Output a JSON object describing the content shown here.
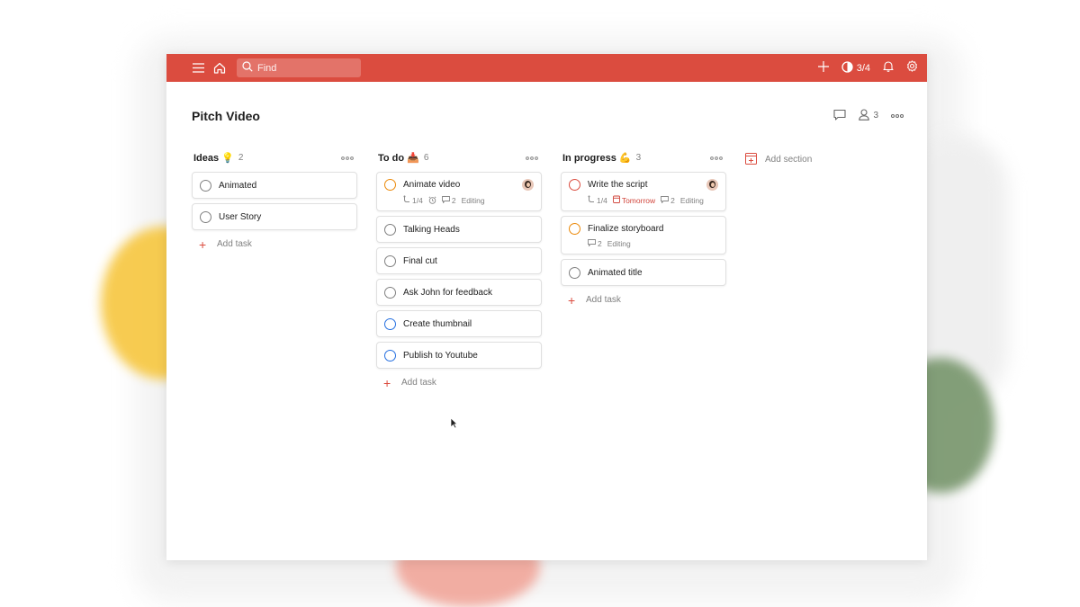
{
  "topbar": {
    "search_placeholder": "Find",
    "karma_label": "3/4",
    "icons": [
      "menu-icon",
      "home-icon",
      "search-icon",
      "plus-icon",
      "karma-icon",
      "bell-icon",
      "gear-icon"
    ]
  },
  "header": {
    "title": "Pitch Video",
    "collaborators_count": "3"
  },
  "columns": [
    {
      "name": "Ideas",
      "emoji": "💡",
      "count": "2",
      "tasks": [
        {
          "name": "Animated",
          "priority": "none"
        },
        {
          "name": "User Story",
          "priority": "none"
        }
      ],
      "add_task_label": "Add task"
    },
    {
      "name": "To do",
      "emoji": "📥",
      "count": "6",
      "tasks": [
        {
          "name": "Animate video",
          "priority": "p2",
          "subtasks": "1/4",
          "comments": "2",
          "label": "Editing",
          "has_reminder": true
        },
        {
          "name": "Talking Heads",
          "priority": "none"
        },
        {
          "name": "Final cut",
          "priority": "none"
        },
        {
          "name": "Ask John for feedback",
          "priority": "none"
        },
        {
          "name": "Create thumbnail",
          "priority": "p3"
        },
        {
          "name": "Publish to Youtube",
          "priority": "p3"
        }
      ],
      "add_task_label": "Add task"
    },
    {
      "name": "In progress",
      "emoji": "💪",
      "count": "3",
      "tasks": [
        {
          "name": "Write the script",
          "priority": "p1",
          "subtasks": "1/4",
          "due": "Tomorrow",
          "comments": "2",
          "label": "Editing"
        },
        {
          "name": "Finalize storyboard",
          "priority": "p2",
          "comments": "2",
          "label": "Editing"
        },
        {
          "name": "Animated title",
          "priority": "none"
        }
      ],
      "add_task_label": "Add task"
    }
  ],
  "add_section_label": "Add section",
  "colors": {
    "brand": "#db4c3f",
    "p1": "#db4c3f",
    "p2": "#eb8909",
    "p3": "#246fe0"
  }
}
